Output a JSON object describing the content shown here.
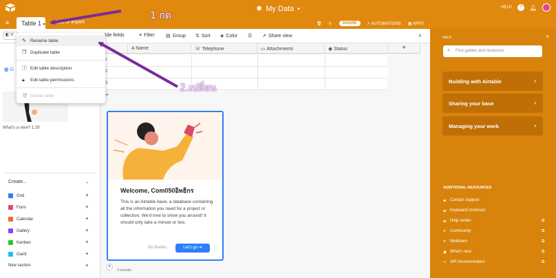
{
  "app": {
    "base_name": "My Data",
    "help_label": "HELP"
  },
  "tabs": {
    "active_table": "Table 1",
    "add_import": "Add or import"
  },
  "header_actions": {
    "share": "SHARE",
    "automations": "AUTOMATIONS",
    "apps": "APPS"
  },
  "toolbar": {
    "hide_fields": "Hide fields",
    "filter": "Filter",
    "group": "Group",
    "sort": "Sort",
    "color": "Color",
    "share_view": "Share view"
  },
  "dropdown": {
    "items": [
      {
        "label": "Rename table",
        "icon": "pencil-icon"
      },
      {
        "label": "Duplicate table",
        "icon": "duplicate-icon"
      },
      {
        "label": "Edit table description",
        "icon": "info-icon"
      },
      {
        "label": "Edit table permissions",
        "icon": "lock-icon"
      },
      {
        "label": "Delete table",
        "icon": "trash-icon"
      }
    ]
  },
  "sidebar": {
    "whats_view": "What's a view? 1:29",
    "create_label": "Create...",
    "create_items": [
      {
        "label": "Grid",
        "color": "#2d7ff9"
      },
      {
        "label": "Form",
        "color": "#e2448a"
      },
      {
        "label": "Calendar",
        "color": "#f06a2c"
      },
      {
        "label": "Gallery",
        "color": "#8b46ff"
      },
      {
        "label": "Kanban",
        "color": "#20c933"
      },
      {
        "label": "Gantt",
        "color": "#18bfff"
      }
    ],
    "new_section": "New section"
  },
  "grid": {
    "columns": [
      "Name",
      "Telephone",
      "Attachments",
      "Status"
    ],
    "rows": [
      "1",
      "2",
      "3"
    ],
    "records_count": "3 records"
  },
  "welcome": {
    "title": "Welcome, Com050อิทธิกร",
    "body": "This is an Airtable base, a database containing all the information you need for a project or collection. We'd love to show you around! It should only take a minute or two.",
    "no_thanks": "No thanks",
    "lets_go": "Let's go"
  },
  "help": {
    "heading": "HELP",
    "search_placeholder": "Find guides and resources",
    "cards": [
      "Building with Airtable",
      "Sharing your base",
      "Managing your work"
    ],
    "additional_resources": "ADDITIONAL RESOURCES",
    "resources": [
      "Contact support",
      "Keyboard shortcuts",
      "Help center",
      "Community",
      "Webinars",
      "What's new",
      "API documentation"
    ]
  },
  "annotations": {
    "step1": "1 กด",
    "step2": "2.เปลี่ยน"
  },
  "colors": {
    "brand_orange": "#e0890e",
    "help_panel": "#d8830b",
    "accent_blue": "#2d7ff9",
    "annotation_arrow": "#7a2a9a"
  }
}
